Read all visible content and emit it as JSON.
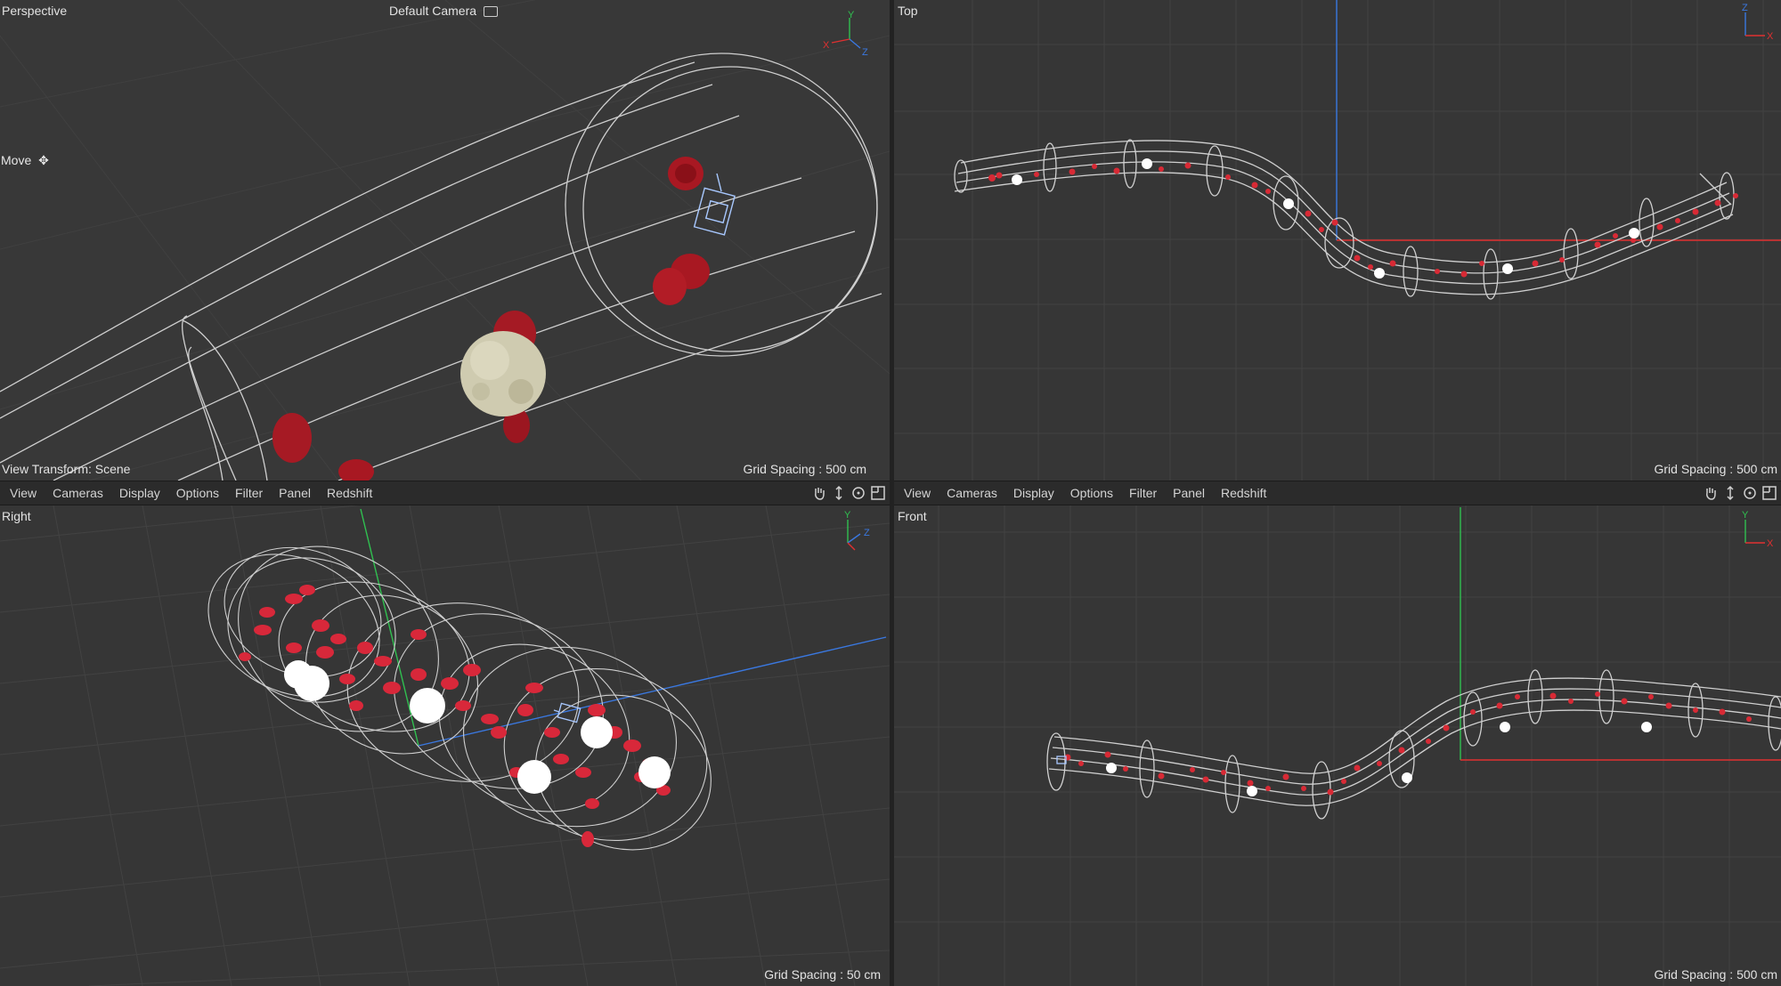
{
  "viewports": {
    "perspective": {
      "name": "Perspective",
      "camera": "Default Camera",
      "mode": "Move",
      "view_transform": "View Transform: Scene",
      "grid_spacing": "Grid Spacing : 500 cm",
      "axes": {
        "x": "X",
        "y": "Y",
        "z": "Z"
      }
    },
    "top": {
      "name": "Top",
      "grid_spacing": "Grid Spacing : 500 cm",
      "axes": {
        "x": "X",
        "z": "Z"
      }
    },
    "right": {
      "name": "Right",
      "grid_spacing": "Grid Spacing : 50 cm",
      "axes": {
        "y": "Y",
        "z": "Z"
      }
    },
    "front": {
      "name": "Front",
      "grid_spacing": "Grid Spacing : 500 cm",
      "axes": {
        "x": "X",
        "y": "Y"
      }
    }
  },
  "menu_left": [
    {
      "label": "View"
    },
    {
      "label": "Cameras"
    },
    {
      "label": "Display"
    },
    {
      "label": "Options"
    },
    {
      "label": "Filter"
    },
    {
      "label": "Panel"
    },
    {
      "label": "Redshift"
    }
  ],
  "menu_right": [
    {
      "label": "View"
    },
    {
      "label": "Cameras"
    },
    {
      "label": "Display"
    },
    {
      "label": "Options"
    },
    {
      "label": "Filter"
    },
    {
      "label": "Panel"
    },
    {
      "label": "Redshift"
    }
  ],
  "tool_icons": [
    "hand-icon",
    "move-arrows-icon",
    "rotate-icon",
    "maximize-icon"
  ],
  "colors": {
    "viewport_bg": "#363636",
    "grid": "#424242",
    "wire": "#d0d0d0",
    "blood_cell": "#c8202c",
    "white_cell": "#ffffff",
    "axis_x": "#e03030",
    "axis_y": "#30c050",
    "axis_z": "#3a78e0"
  }
}
